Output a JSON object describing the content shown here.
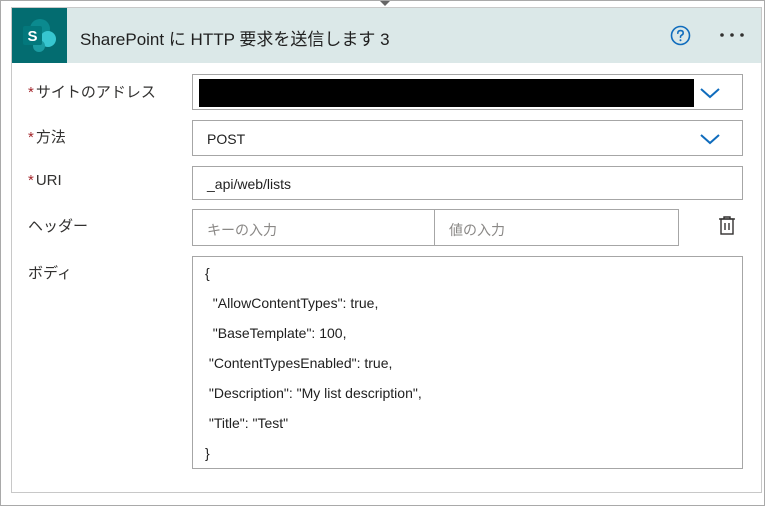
{
  "action": {
    "title": "SharePoint に HTTP 要求を送信します 3",
    "icon": "sharepoint-icon",
    "help_icon": "help-circle-icon",
    "more_icon": "more-ellipsis-icon"
  },
  "fields": {
    "site_address": {
      "label": "サイトのアドレス",
      "required": "*"
    },
    "method": {
      "label": "方法",
      "required": "*",
      "value": "POST"
    },
    "uri": {
      "label": "URI",
      "required": "*",
      "value": "_api/web/lists"
    },
    "headers": {
      "label": "ヘッダー",
      "key_placeholder": "キーの入力",
      "value_placeholder": "値の入力"
    },
    "body": {
      "label": "ボディ",
      "lines": [
        "{",
        "  \"AllowContentTypes\": true,",
        "  \"BaseTemplate\": 100,",
        " \"ContentTypesEnabled\": true,",
        " \"Description\": \"My list description\",",
        " \"Title\": \"Test\"",
        "}"
      ]
    }
  },
  "colors": {
    "header_bg": "#dbe8e8",
    "icon_bg": "#036c70",
    "accent": "#0f6cbd",
    "required": "#a4262c"
  }
}
